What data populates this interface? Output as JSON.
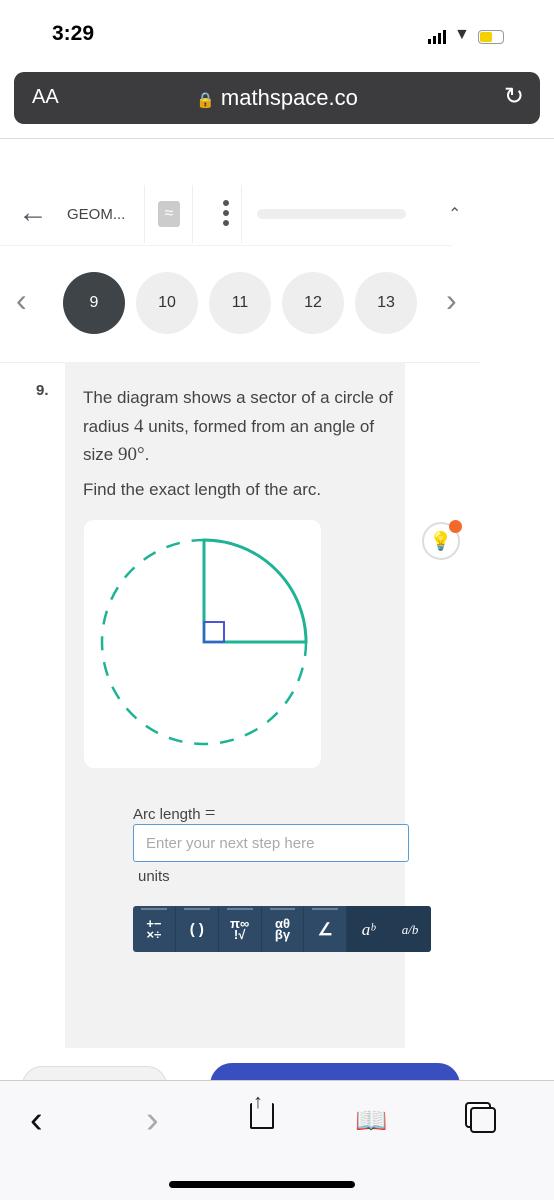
{
  "status": {
    "time": "3:29"
  },
  "browser": {
    "text_size": "AA",
    "url": "mathspace.co"
  },
  "header": {
    "title": "GEOM..."
  },
  "pager": {
    "items": [
      "9",
      "10",
      "11",
      "12",
      "13"
    ],
    "active": "9"
  },
  "question": {
    "number": "9.",
    "line1": "The diagram shows a sector of a circle of radius ",
    "radius": "4",
    "line2": " units, formed from an angle of size ",
    "angle": "90°",
    "line3": ".",
    "prompt": "Find the exact length of the arc."
  },
  "diagram": {
    "sector_color": "#1db394",
    "right_angle_color": "#4a55d8"
  },
  "answer": {
    "label": "Arc length",
    "equals": "=",
    "placeholder": "Enter your next step here",
    "unit": "units"
  },
  "keyboard": {
    "keys": [
      "+−\n×÷",
      "( )",
      "π∞\n!√",
      "αθ\nβγ",
      "∠",
      "aᵇ",
      "a/b"
    ]
  },
  "colors": {
    "submit": "#3a4fbf",
    "hint_badge": "#f26b2a",
    "hint_icon": "#2c3fb8"
  }
}
